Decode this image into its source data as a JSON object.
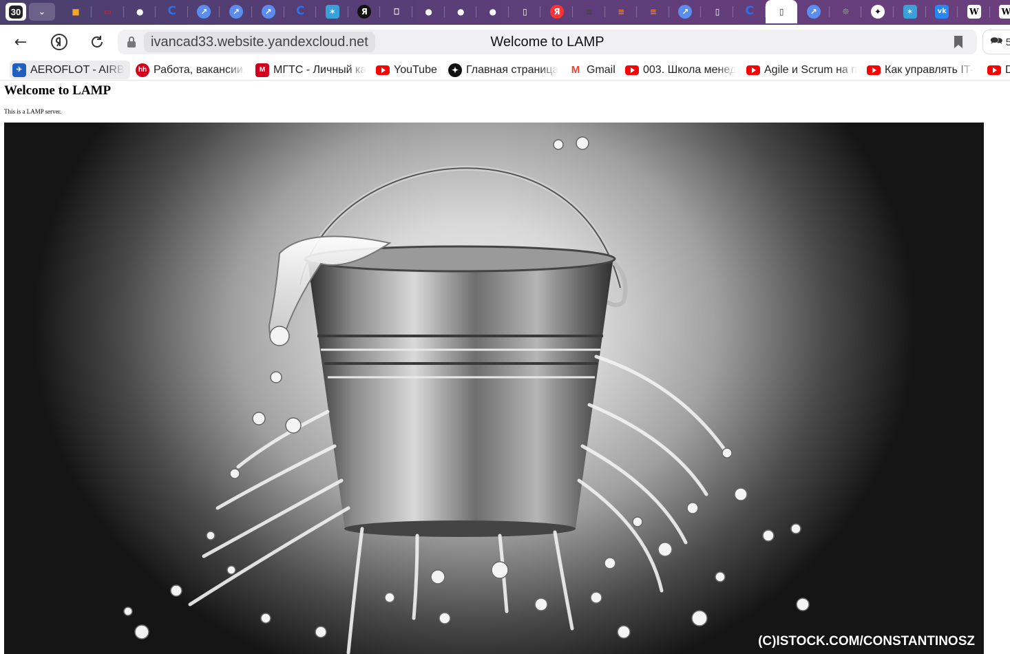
{
  "tabs": {
    "counter": "30",
    "items": [
      {
        "icon": "box-icon",
        "color": "#f5a623"
      },
      {
        "icon": "monitor-icon",
        "color": "#e8202a"
      },
      {
        "icon": "github-icon",
        "color": "#ffffff"
      },
      {
        "icon": "c-icon",
        "color": "#2f6fe8"
      },
      {
        "icon": "compass-icon",
        "color": "#5b8def"
      },
      {
        "icon": "compass-icon",
        "color": "#5b8def"
      },
      {
        "icon": "compass-icon",
        "color": "#5b8def"
      },
      {
        "icon": "c-icon",
        "color": "#2f6fe8"
      },
      {
        "icon": "gear-icon",
        "color": "#3aa0d8"
      },
      {
        "icon": "yandex-icon",
        "color": "#111111"
      },
      {
        "icon": "doc-icon",
        "color": "#ffffff"
      },
      {
        "icon": "github-icon",
        "color": "#ffffff"
      },
      {
        "icon": "github-icon",
        "color": "#ffffff"
      },
      {
        "icon": "github-icon",
        "color": "#ffffff"
      },
      {
        "icon": "page-icon",
        "color": "#ffffff"
      },
      {
        "icon": "yandex-icon",
        "color": "#f33"
      },
      {
        "icon": "grid-icon",
        "color": "#444444"
      },
      {
        "icon": "stack-icon",
        "color": "#f48024"
      },
      {
        "icon": "stack-icon",
        "color": "#f48024"
      },
      {
        "icon": "compass-icon",
        "color": "#5b8def"
      },
      {
        "icon": "page-icon",
        "color": "#ffffff"
      },
      {
        "icon": "c-icon",
        "color": "#2f6fe8"
      },
      {
        "icon": "page-icon",
        "color": "#333333"
      },
      {
        "icon": "compass-icon",
        "color": "#5b8def"
      },
      {
        "icon": "spider-icon",
        "color": "#888888"
      },
      {
        "icon": "star-icon",
        "color": "#111111"
      },
      {
        "icon": "gear-icon",
        "color": "#3aa0d8"
      },
      {
        "icon": "vk-icon",
        "color": "#2787f5"
      },
      {
        "icon": "wikipedia-icon",
        "color": "#ffffff"
      },
      {
        "icon": "wikipedia-icon",
        "color": "#ffffff"
      }
    ]
  },
  "toolbar": {
    "url": "ivancad33.website.yandexcloud.net",
    "page_title": "Welcome to LAMP",
    "chat_count": "5"
  },
  "bookmarks": [
    {
      "label": "AEROFLOT - AIRB",
      "icon": "aeroflot-icon"
    },
    {
      "label": "Работа, вакансии,",
      "icon": "hh-icon"
    },
    {
      "label": "МГТС - Личный ка",
      "icon": "mgts-icon"
    },
    {
      "label": "YouTube",
      "icon": "youtube-icon"
    },
    {
      "label": "Главная страница",
      "icon": "star-icon"
    },
    {
      "label": "Gmail",
      "icon": "gmail-icon"
    },
    {
      "label": "003. Школа менед",
      "icon": "youtube-icon"
    },
    {
      "label": "Agile и Scrum на п",
      "icon": "youtube-icon"
    },
    {
      "label": "Как управлять IT-",
      "icon": "youtube-icon"
    },
    {
      "label": "D",
      "icon": "youtube-icon"
    }
  ],
  "page": {
    "heading": "Welcome to LAMP",
    "text": "This is a LAMP server.",
    "image_watermark": "(C)ISTOCK.COM/CONSTANTINOSZ"
  }
}
